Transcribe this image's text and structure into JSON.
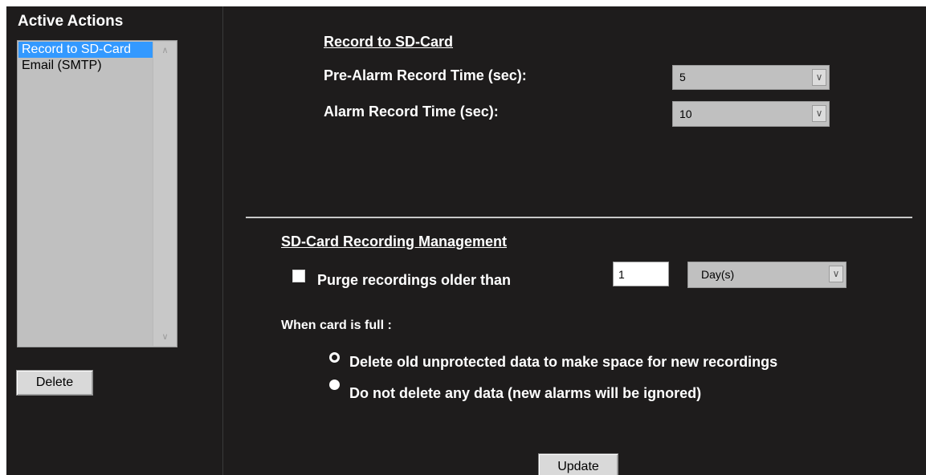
{
  "sidebar": {
    "title": "Active Actions",
    "items": [
      {
        "label": "Record to SD-Card",
        "selected": true
      },
      {
        "label": "Email (SMTP)",
        "selected": false
      }
    ],
    "delete_label": "Delete"
  },
  "record": {
    "heading": "Record to SD-Card",
    "pre_alarm_label": "Pre-Alarm Record Time (sec):",
    "pre_alarm_value": "5",
    "alarm_label": "Alarm Record Time (sec):",
    "alarm_value": "10"
  },
  "management": {
    "heading": "SD-Card Recording Management",
    "purge_label": "Purge recordings older than",
    "purge_checked": false,
    "purge_amount": "1",
    "purge_unit": "Day(s)",
    "full_label": "When card is full :",
    "option_delete": "Delete old unprotected data to make space for new recordings",
    "option_keep": "Do not delete any data (new alarms will be ignored)",
    "selected_option": "keep"
  },
  "update_label": "Update",
  "colors": {
    "background": "#1e1c1c",
    "selection": "#3399ff",
    "listbox": "#c0c0c0",
    "button": "#d9d9d9"
  }
}
